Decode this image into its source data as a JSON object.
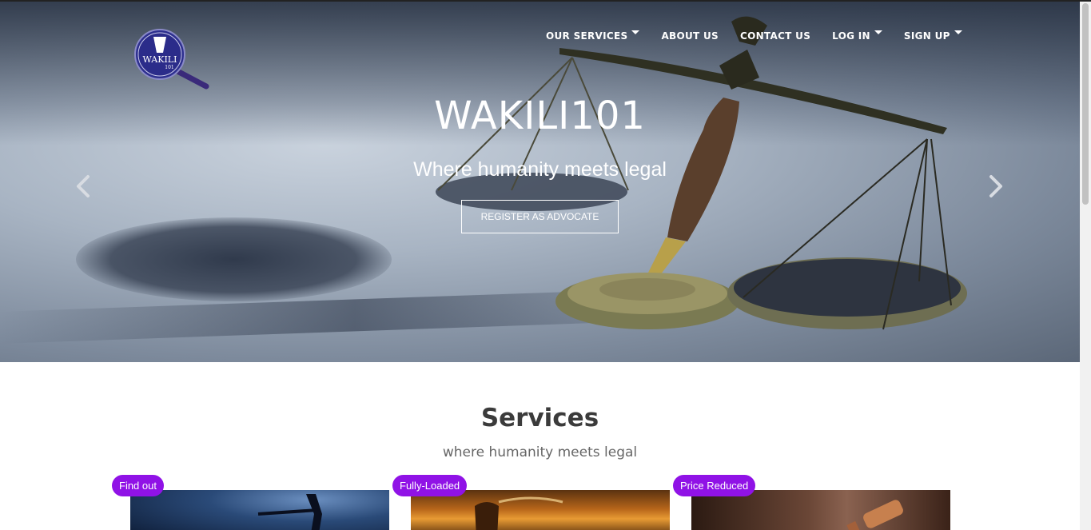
{
  "brand": {
    "logo_text": "WAKILI",
    "logo_subtext": "101"
  },
  "nav": {
    "items": [
      {
        "label": "OUR SERVICES",
        "has_dropdown": true
      },
      {
        "label": "ABOUT US",
        "has_dropdown": false
      },
      {
        "label": "CONTACT US",
        "has_dropdown": false
      },
      {
        "label": "LOG IN",
        "has_dropdown": true
      },
      {
        "label": "SIGN UP",
        "has_dropdown": true
      }
    ]
  },
  "hero": {
    "title": "WAKILI101",
    "subtitle": "Where humanity meets legal",
    "button_label": "REGISTER AS ADVOCATE",
    "prev_icon": "chevron-left-icon",
    "next_icon": "chevron-right-icon"
  },
  "services": {
    "title": "Services",
    "subtitle": "where humanity meets legal",
    "cards": [
      {
        "badge": "Find out"
      },
      {
        "badge": "Fully-Loaded"
      },
      {
        "badge": "Price Reduced"
      }
    ]
  },
  "colors": {
    "accent_badge": "#9012e6",
    "heading": "#3b3b3b",
    "nav_text": "#ffffff"
  }
}
